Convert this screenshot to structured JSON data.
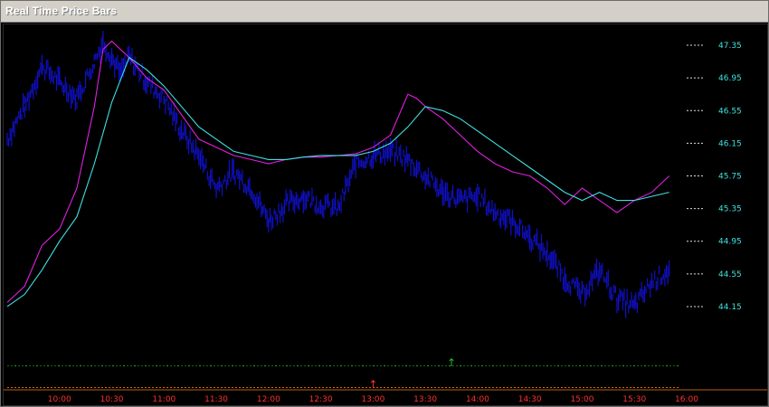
{
  "window": {
    "title": "Real Time Price Bars"
  },
  "colors": {
    "background": "#000000",
    "price_bars": "#1010c8",
    "magenta_line": "#e020e0",
    "cyan_line": "#40e0e0",
    "y_labels": "#40e0e0",
    "x_labels": "#ff3030",
    "green_markers": "#20c020",
    "orange_markers": "#ff8c00"
  },
  "chart_data": {
    "type": "line",
    "title": "Real Time Price Bars",
    "ylim": [
      43.95,
      47.55
    ],
    "y_ticks": [
      "47.35",
      "46.95",
      "46.55",
      "46.15",
      "45.75",
      "45.35",
      "44.95",
      "44.55",
      "44.15"
    ],
    "x_ticks": [
      "10:00",
      "10:30",
      "11:00",
      "11:30",
      "12:00",
      "12:30",
      "13:00",
      "13:30",
      "14:00",
      "14:30",
      "15:00",
      "15:30",
      "16:00"
    ],
    "x_minutes_start": "09:30",
    "series": [
      {
        "key": "price",
        "x": [
          "09:30",
          "09:40",
          "09:50",
          "10:00",
          "10:10",
          "10:20",
          "10:25",
          "10:30",
          "10:35",
          "10:40",
          "10:50",
          "11:00",
          "11:10",
          "11:20",
          "11:30",
          "11:40",
          "11:50",
          "12:00",
          "12:10",
          "12:20",
          "12:30",
          "12:40",
          "12:50",
          "13:00",
          "13:10",
          "13:20",
          "13:30",
          "13:40",
          "13:50",
          "14:00",
          "14:10",
          "14:20",
          "14:30",
          "14:40",
          "14:50",
          "15:00",
          "15:10",
          "15:20",
          "15:30",
          "15:40",
          "15:50"
        ],
        "values": [
          46.2,
          46.6,
          47.1,
          46.9,
          46.7,
          47.15,
          47.4,
          47.2,
          47.0,
          47.2,
          46.9,
          46.7,
          46.3,
          46.0,
          45.6,
          45.8,
          45.6,
          45.2,
          45.4,
          45.5,
          45.4,
          45.35,
          45.9,
          46.0,
          46.05,
          45.95,
          45.75,
          45.55,
          45.45,
          45.5,
          45.3,
          45.2,
          45.0,
          44.8,
          44.5,
          44.3,
          44.6,
          44.25,
          44.15,
          44.45,
          44.6
        ]
      },
      {
        "key": "magenta",
        "x": [
          "09:30",
          "09:40",
          "09:50",
          "10:00",
          "10:10",
          "10:20",
          "10:25",
          "10:30",
          "10:40",
          "10:50",
          "11:00",
          "11:10",
          "11:20",
          "11:30",
          "11:40",
          "11:50",
          "12:00",
          "12:10",
          "12:20",
          "12:30",
          "12:40",
          "12:50",
          "13:00",
          "13:10",
          "13:20",
          "13:25",
          "13:30",
          "13:40",
          "13:50",
          "14:00",
          "14:10",
          "14:20",
          "14:30",
          "14:40",
          "14:50",
          "15:00",
          "15:10",
          "15:20",
          "15:30",
          "15:40",
          "15:50"
        ],
        "values": [
          44.2,
          44.4,
          44.9,
          45.1,
          45.6,
          46.6,
          47.3,
          47.4,
          47.2,
          46.95,
          46.8,
          46.5,
          46.2,
          46.1,
          46.0,
          45.95,
          45.9,
          45.95,
          45.98,
          45.98,
          46.0,
          46.02,
          46.1,
          46.25,
          46.75,
          46.7,
          46.6,
          46.45,
          46.25,
          46.05,
          45.9,
          45.8,
          45.75,
          45.6,
          45.4,
          45.6,
          45.45,
          45.3,
          45.45,
          45.55,
          45.75
        ]
      },
      {
        "key": "cyan",
        "x": [
          "09:30",
          "09:40",
          "09:50",
          "10:00",
          "10:10",
          "10:20",
          "10:30",
          "10:40",
          "10:50",
          "11:00",
          "11:10",
          "11:20",
          "11:30",
          "11:40",
          "11:50",
          "12:00",
          "12:10",
          "12:20",
          "12:30",
          "12:40",
          "12:50",
          "13:00",
          "13:10",
          "13:20",
          "13:30",
          "13:40",
          "13:50",
          "14:00",
          "14:10",
          "14:20",
          "14:30",
          "14:40",
          "14:50",
          "15:00",
          "15:10",
          "15:20",
          "15:30",
          "15:40",
          "15:50"
        ],
        "values": [
          44.15,
          44.3,
          44.6,
          44.95,
          45.25,
          45.9,
          46.65,
          47.2,
          47.05,
          46.85,
          46.6,
          46.35,
          46.2,
          46.05,
          46.0,
          45.95,
          45.95,
          45.98,
          46.0,
          46.0,
          46.0,
          46.05,
          46.15,
          46.35,
          46.6,
          46.55,
          46.45,
          46.3,
          46.15,
          46.0,
          45.85,
          45.7,
          45.55,
          45.45,
          45.55,
          45.45,
          45.45,
          45.5,
          45.55
        ]
      }
    ],
    "markers": [
      {
        "label": "↑",
        "x": "13:00",
        "color_key": "x_labels",
        "row": "bottom"
      },
      {
        "label": "↑",
        "x": "13:45",
        "color_key": "green_markers",
        "row": "top"
      }
    ]
  }
}
